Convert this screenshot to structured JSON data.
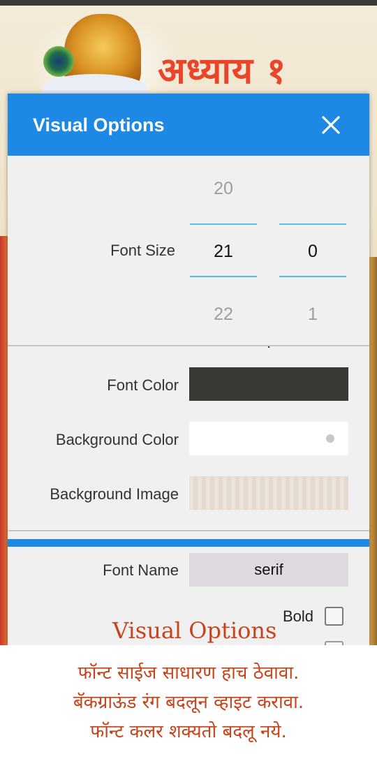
{
  "background": {
    "chapter_title": "अध्याय १"
  },
  "dialog": {
    "title": "Visual Options",
    "font_size": {
      "label": "Font Size",
      "integer": {
        "above": "20",
        "current": "21",
        "below": "22"
      },
      "separator": ".",
      "fraction": {
        "above": "",
        "current": "0",
        "below": "1"
      }
    },
    "font_color": {
      "label": "Font Color",
      "value": "#3a3935"
    },
    "background_color": {
      "label": "Background Color",
      "value": "#ffffff"
    },
    "background_image": {
      "label": "Background Image"
    },
    "font_name": {
      "label": "Font Name",
      "value": "serif"
    },
    "bold": {
      "label": "Bold",
      "checked": false
    }
  },
  "overlay_caption": "Visual Options",
  "notes": [
    "फॉन्ट साईज साधारण हाच ठेवावा.",
    "बॅकग्राऊंड रंग बदलून व्हाइट करावा.",
    "फॉन्ट कलर शक्यतो बदलू नये."
  ],
  "colors": {
    "accent": "#1e88e5",
    "note_text": "#c8431b",
    "chapter_title": "#e8452a",
    "picker_line": "#5bbbe8"
  },
  "icons": {
    "close": "close-icon"
  }
}
